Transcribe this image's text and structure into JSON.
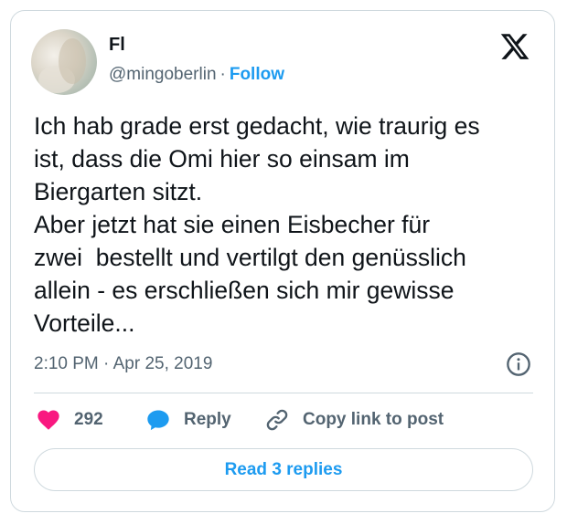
{
  "author": {
    "name": "Fl",
    "handle": "@mingoberlin",
    "separator": "·",
    "follow_label": "Follow"
  },
  "platform_icon": "x-logo-icon",
  "tweet": {
    "text": "Ich hab grade erst gedacht, wie traurig es\nist, dass die Omi hier so einsam im\nBiergarten sitzt.\nAber jetzt hat sie einen Eisbecher für\nzwei  bestellt und vertilgt den genüsslich\nallein - es erschließen sich mir gewisse\nVorteile...",
    "timestamp": "2:10 PM · Apr 25, 2019"
  },
  "actions": {
    "like_count": "292",
    "reply_label": "Reply",
    "copy_label": "Copy link to post"
  },
  "read_replies_label": "Read 3 replies",
  "colors": {
    "accent": "#1d9bf0",
    "like": "#f91880",
    "secondary_text": "#536471",
    "border": "#cfd9de"
  }
}
